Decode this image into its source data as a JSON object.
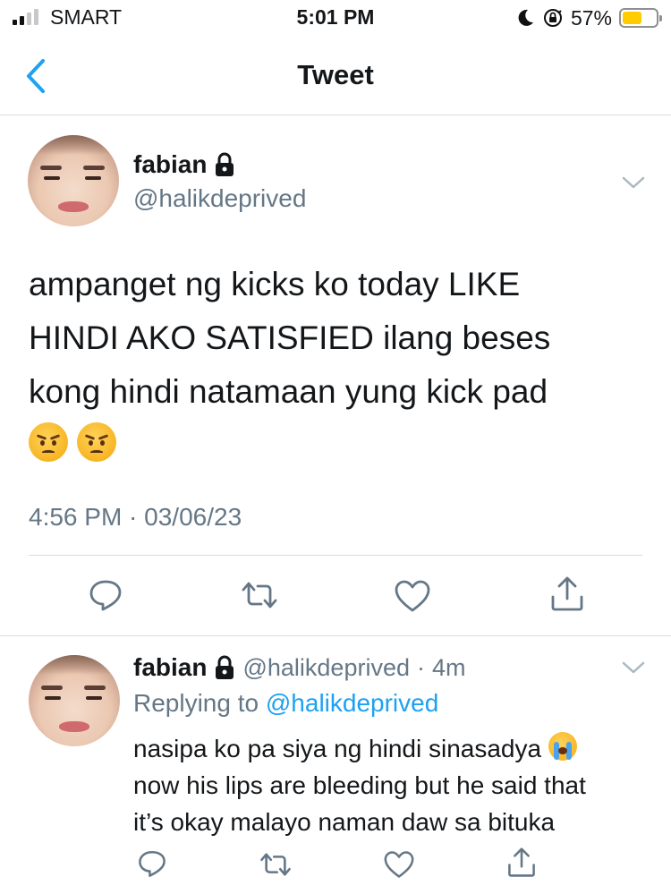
{
  "status_bar": {
    "carrier": "SMART",
    "time": "5:01 PM",
    "battery_percent": "57%",
    "battery_level": 0.57,
    "colors": {
      "battery_fill": "#ffcc00"
    }
  },
  "nav": {
    "title": "Tweet",
    "back_icon": "chevron-left-icon",
    "accent_color": "#1da1f2"
  },
  "tweet": {
    "author_name": "fabian",
    "locked": true,
    "handle": "@halikdeprived",
    "text_lines": [
      "ampanget ng kicks ko today LIKE",
      "HINDI AKO SATISFIED ilang beses",
      "kong hindi natamaan yung kick pad"
    ],
    "emojis": [
      "angry-face-emoji",
      "angry-face-emoji"
    ],
    "timestamp": "4:56 PM · 03/06/23",
    "actions": [
      "reply-icon",
      "retweet-icon",
      "like-icon",
      "share-icon"
    ]
  },
  "reply": {
    "author_name": "fabian",
    "locked": true,
    "handle": "@halikdeprived",
    "separator": "·",
    "age": "4m",
    "replying_prefix": "Replying to",
    "replying_to": "@halikdeprived",
    "text_line1": "nasipa ko pa siya ng hindi sinasadya",
    "text_line1_emoji": "loudly-crying-face-emoji",
    "text_line2": "now his lips are bleeding but he said that",
    "text_line3": "it’s okay malayo naman daw sa bituka",
    "actions": [
      "reply-icon",
      "retweet-icon",
      "like-icon",
      "share-icon"
    ]
  }
}
